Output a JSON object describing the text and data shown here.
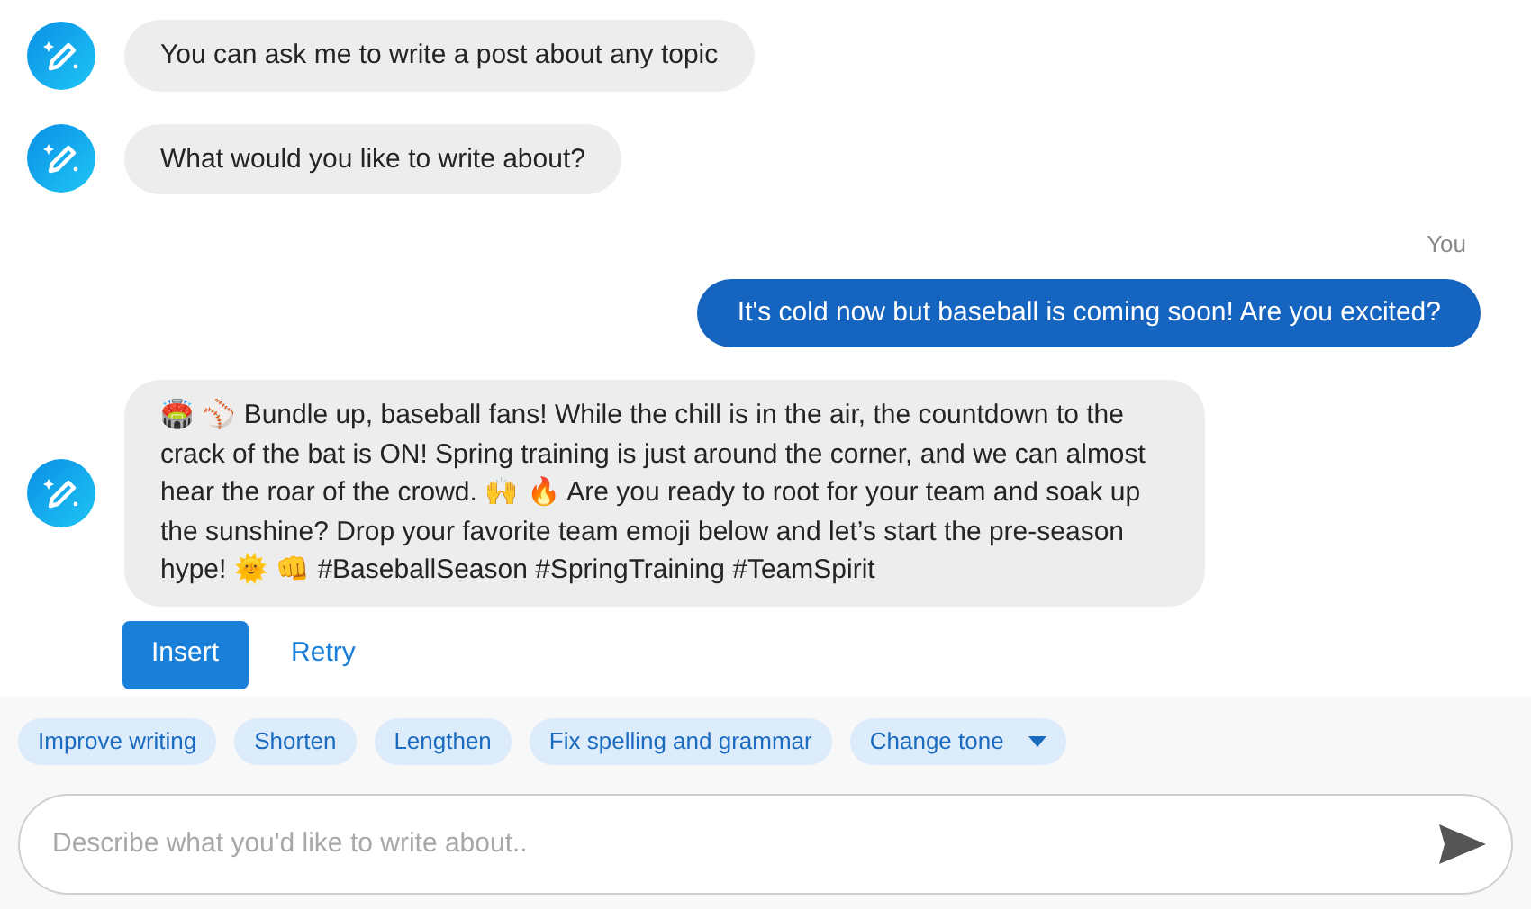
{
  "messages": [
    {
      "kind": "bot",
      "text": "You can ask me to write a post about any topic"
    },
    {
      "kind": "bot",
      "text": "What would you like to write about?"
    },
    {
      "kind": "user",
      "sender": "You",
      "text": "It's cold now but baseball is coming soon! Are you excited?"
    },
    {
      "kind": "bot",
      "text": "🏟️ ⚾ Bundle up, baseball fans! While the chill is in the air, the countdown to the crack of the bat is ON! Spring training is just around the corner, and we can almost hear the roar of the crowd. 🙌 🔥  Are you ready to root for your team and soak up the sunshine? Drop your favorite team emoji below and let’s start the pre-season hype! 🌞 👊  #BaseballSeason #SpringTraining #TeamSpirit",
      "actions": [
        {
          "label": "Insert",
          "kind": "primary"
        },
        {
          "label": "Retry",
          "kind": "link"
        }
      ]
    }
  ],
  "suggestions": [
    {
      "label": "Improve writing",
      "dropdown": false
    },
    {
      "label": "Shorten",
      "dropdown": false
    },
    {
      "label": "Lengthen",
      "dropdown": false
    },
    {
      "label": "Fix spelling and grammar",
      "dropdown": false
    },
    {
      "label": "Change tone",
      "dropdown": true
    }
  ],
  "composer": {
    "placeholder": "Describe what you'd like to write about.."
  }
}
